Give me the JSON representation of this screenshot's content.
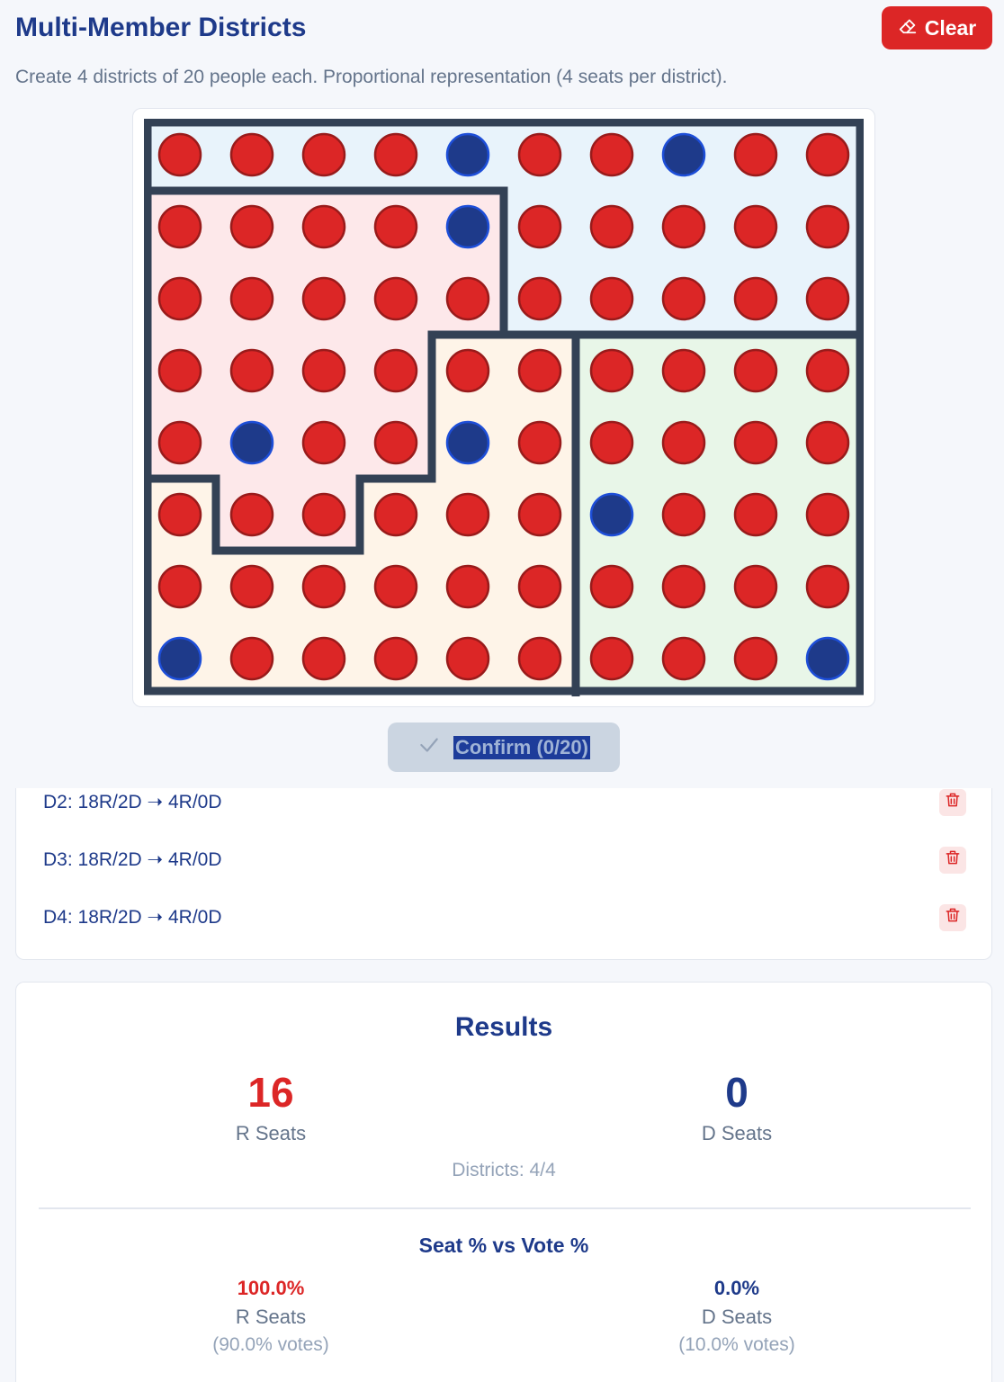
{
  "header": {
    "title": "Multi-Member Districts",
    "clear_label": "Clear",
    "subtitle": "Create 4 districts of 20 people each. Proportional representation (4 seats per district)."
  },
  "colors": {
    "red_voter": "#dc2626",
    "blue_voter": "#1e3a8a",
    "district_fills": {
      "1": "#e8f3fb",
      "2": "#fde8ea",
      "3": "#fef4e8",
      "4": "#e8f6e8"
    },
    "border": "#334155"
  },
  "board": {
    "rows": 8,
    "cols": 10,
    "voters": [
      "RRRRBRRBRR",
      "RRRRBRRRRR",
      "RRRRRRRRRR",
      "RRRRRRRRRR",
      "RBRRBRRRRR",
      "RRRRRRBRRR",
      "RRRRRRRRRR",
      "BRRRRRRRRB"
    ],
    "districts": [
      "1111111111",
      "2222211111",
      "2222211111",
      "2222334444",
      "2222334444",
      "3223334444",
      "3333334444",
      "3333334444"
    ]
  },
  "confirm": {
    "label": "Confirm (0/20)",
    "icon": "check-icon"
  },
  "district_list": [
    {
      "id": "2",
      "text": "D2: 18R/2D ➝ 4R/0D",
      "icon": "trash-icon"
    },
    {
      "id": "3",
      "text": "D3: 18R/2D ➝ 4R/0D",
      "icon": "trash-icon"
    },
    {
      "id": "4",
      "text": "D4: 18R/2D ➝ 4R/0D",
      "icon": "trash-icon"
    }
  ],
  "results": {
    "title": "Results",
    "r_seats": "16",
    "r_seats_label": "R Seats",
    "d_seats": "0",
    "d_seats_label": "D Seats",
    "districts_count": "Districts: 4/4",
    "pct_title": "Seat % vs Vote %",
    "r_pct": "100.0%",
    "r_pct_label": "R Seats",
    "r_votes": "(90.0% votes)",
    "d_pct": "0.0%",
    "d_pct_label": "D Seats",
    "d_votes": "(10.0% votes)"
  }
}
